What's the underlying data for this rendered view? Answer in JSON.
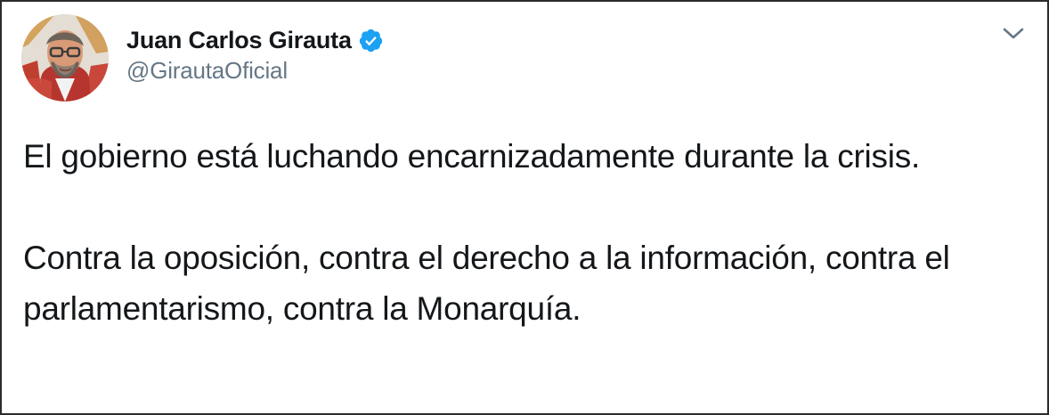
{
  "tweet": {
    "author": {
      "display_name": "Juan Carlos Girauta",
      "handle": "@GirautaOficial",
      "verified_icon": "verified-badge-icon",
      "avatar_icon": "profile-photo"
    },
    "menu_icon": "chevron-down-icon",
    "text": {
      "paragraph_1": "El gobierno está luchando encarnizadamente durante la crisis.",
      "paragraph_2": "Contra la oposición, contra el derecho a la información, contra el parlamentarismo, contra la Monarquía."
    }
  },
  "colors": {
    "text_primary": "#14171a",
    "text_secondary": "#657786",
    "verified_blue": "#1da1f2",
    "border": "#2b2b2b"
  }
}
